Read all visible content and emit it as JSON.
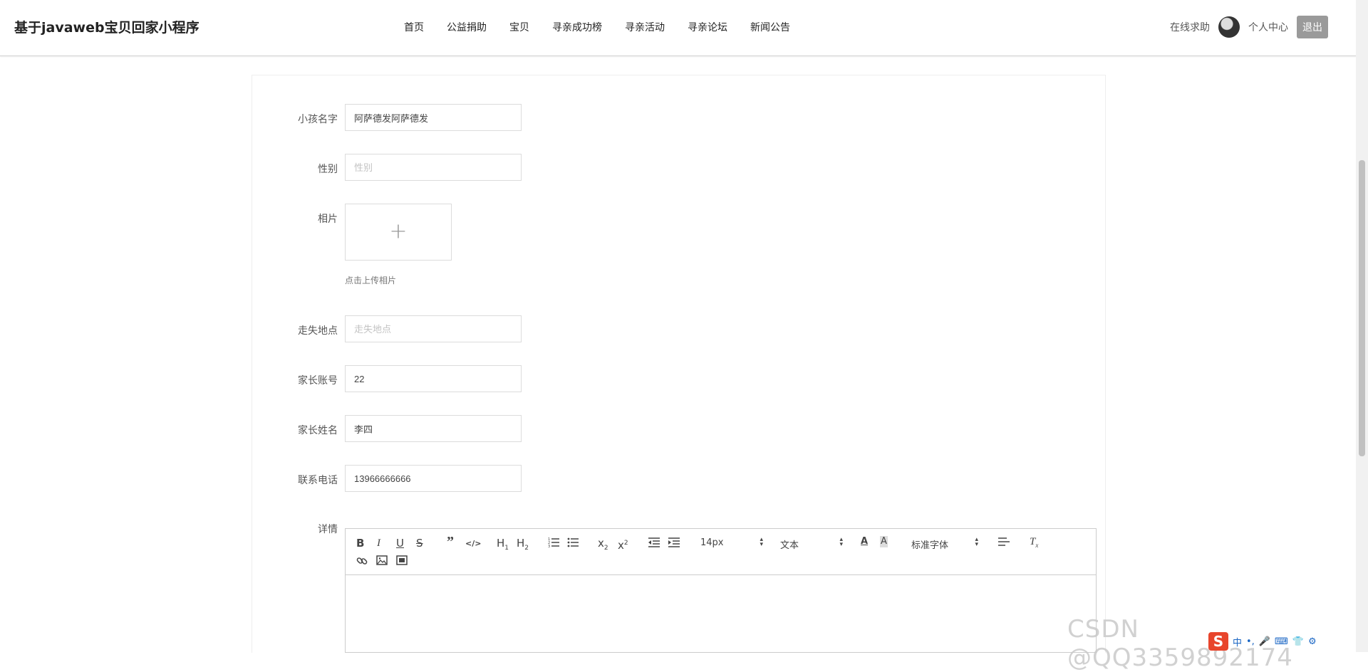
{
  "header": {
    "brand": "基于javaweb宝贝回家小程序",
    "nav": [
      "首页",
      "公益捐助",
      "宝贝",
      "寻亲成功榜",
      "寻亲活动",
      "寻亲论坛",
      "新闻公告"
    ],
    "online_help": "在线求助",
    "profile": "个人中心",
    "logout": "退出"
  },
  "form": {
    "child_name": {
      "label": "小孩名字",
      "value": "阿萨德发阿萨德发"
    },
    "gender": {
      "label": "性别",
      "placeholder": "性别"
    },
    "photo": {
      "label": "相片",
      "hint": "点击上传相片"
    },
    "lost_place": {
      "label": "走失地点",
      "placeholder": "走失地点"
    },
    "parent_account": {
      "label": "家长账号",
      "value": "22"
    },
    "parent_name": {
      "label": "家长姓名",
      "value": "李四"
    },
    "phone": {
      "label": "联系电话",
      "value": "13966666666"
    },
    "details": {
      "label": "详情",
      "toolbar": {
        "font_size": "14px",
        "paragraph": "文本",
        "font_family": "标准字体"
      }
    }
  },
  "watermark": "CSDN @QQ3359892174",
  "ime": {
    "lang": "中"
  },
  "colors": {
    "logout_bg": "#9a9a9a",
    "border": "#dcdcdc"
  }
}
